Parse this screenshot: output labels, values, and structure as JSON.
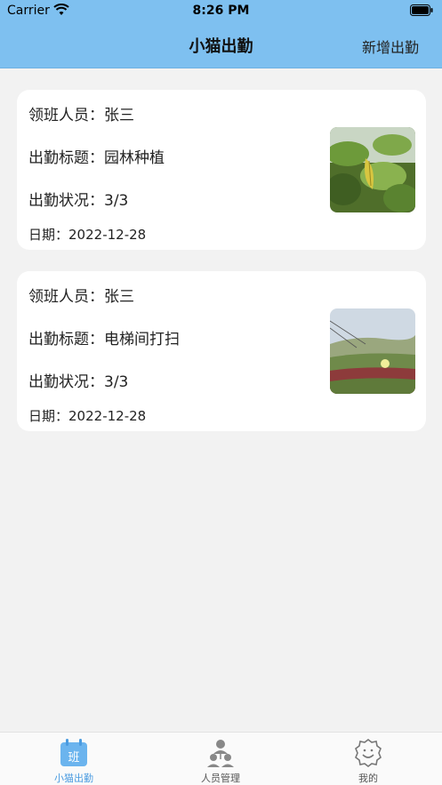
{
  "status_bar": {
    "carrier": "Carrier",
    "time": "8:26 PM"
  },
  "nav": {
    "title": "小猫出勤",
    "action_label": "新增出勤"
  },
  "cards": [
    {
      "leader_label": "领班人员：",
      "leader": "张三",
      "title_label": "出勤标题：",
      "title": "园林种植",
      "status_label": "出勤状况：",
      "status": "3/3",
      "date_label": "日期：",
      "date": "2022-12-28",
      "image": "leaf-photo"
    },
    {
      "leader_label": "领班人员：",
      "leader": "张三",
      "title_label": "出勤标题：",
      "title": "电梯间打扫",
      "status_label": "出勤状况：",
      "status": "3/3",
      "date_label": "日期：",
      "date": "2022-12-28",
      "image": "meadow-photo"
    }
  ],
  "tabs": [
    {
      "label": "小猫出勤",
      "icon": "calendar-icon",
      "badge": "班",
      "active": true
    },
    {
      "label": "人员管理",
      "icon": "people-icon",
      "active": false
    },
    {
      "label": "我的",
      "icon": "profile-gear-icon",
      "active": false
    }
  ],
  "colors": {
    "header": "#7ec0f0",
    "accent": "#4a9be0",
    "background": "#f2f2f2"
  }
}
